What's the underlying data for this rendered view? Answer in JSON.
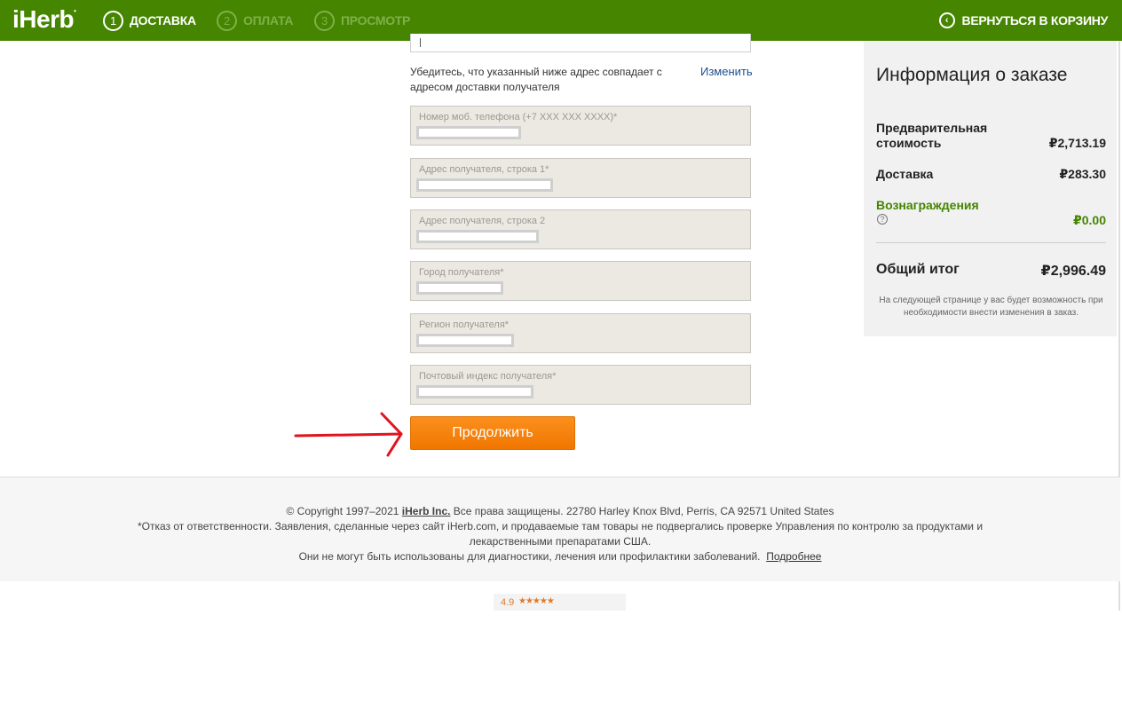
{
  "header": {
    "logo": "iHerb",
    "steps": [
      {
        "num": "1",
        "label": "ДОСТАВКА"
      },
      {
        "num": "2",
        "label": "ОПЛАТА"
      },
      {
        "num": "3",
        "label": "ПРОСМОТР"
      }
    ],
    "back_label": "ВЕРНУТЬСЯ В КОРЗИНУ"
  },
  "form": {
    "notice": "Убедитесь, что указанный ниже адрес совпадает с адресом доставки получателя",
    "change_label": "Изменить",
    "fields": [
      {
        "label": "Номер моб. телефона (+7 XXX XXX XXXX)*"
      },
      {
        "label": "Адрес получателя, строка 1*"
      },
      {
        "label": "Адрес получателя, строка 2"
      },
      {
        "label": "Город получателя*"
      },
      {
        "label": "Регион получателя*"
      },
      {
        "label": "Почтовый индекс получателя*"
      }
    ],
    "continue_label": "Продолжить"
  },
  "summary": {
    "title": "Информация о заказе",
    "subtotal_label_1": "Предварительная",
    "subtotal_label_2": "стоимость",
    "subtotal_value": "₽2,713.19",
    "shipping_label": "Доставка",
    "shipping_value": "₽283.30",
    "rewards_label": "Вознаграждения",
    "rewards_value": "₽0.00",
    "help_icon": "?",
    "total_label": "Общий итог",
    "total_value": "₽2,996.49",
    "note": "На следующей странице у вас будет возможность при необходимости внести изменения в заказ."
  },
  "footer": {
    "copyright_pre": "© Copyright 1997–2021 ",
    "company": "iHerb Inc.",
    "copyright_post": " Все права защищены. 22780 Harley Knox Blvd, Perris, CA 92571 United States",
    "disclaimer_1": "*Отказ от ответственности. Заявления, сделанные через сайт iHerb.com, и продаваемые там товары не подвергались проверке Управления по контролю за продуктами и",
    "disclaimer_2": "лекарственными препаратами США.",
    "disclaimer_3": "Они не могут быть использованы для диагностики, лечения или профилактики заболеваний.",
    "more_link": "Подробнее"
  },
  "rating": {
    "score": "4.9",
    "stars": "★★★★★"
  },
  "colors": {
    "header_green": "#458500",
    "button_orange": "#f58220",
    "rewards_green": "#458500",
    "link_blue": "#1a4f8f",
    "arrow_red": "#e0141e"
  }
}
